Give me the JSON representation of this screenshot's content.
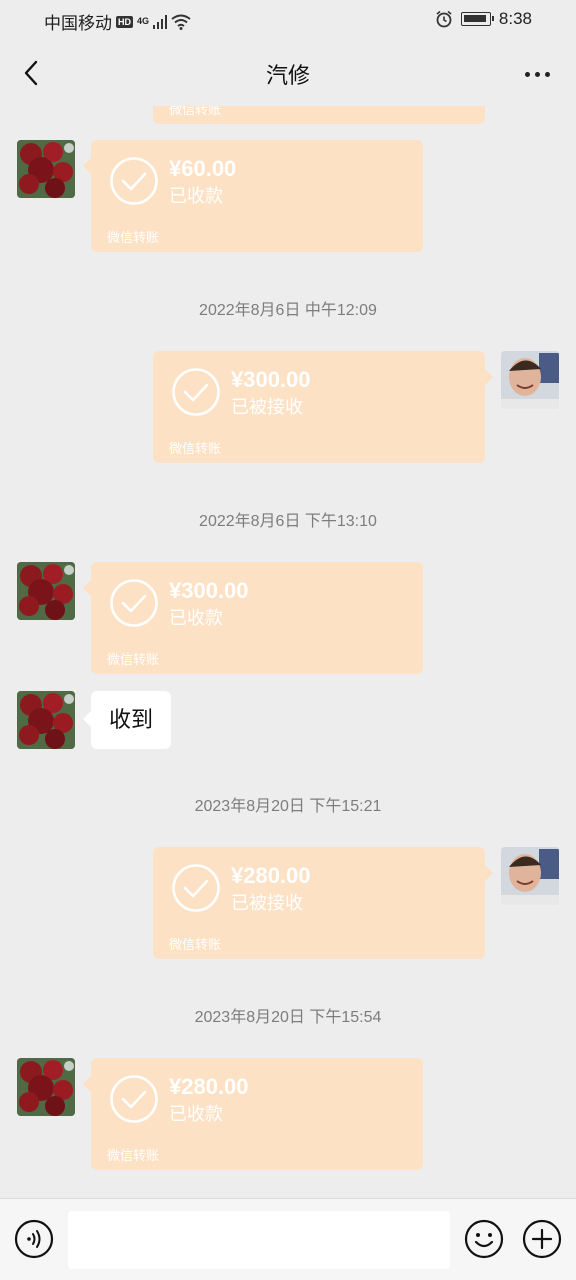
{
  "status_bar": {
    "carrier": "中国移动",
    "hd": "HD",
    "network": "4G",
    "time": "8:38"
  },
  "header": {
    "title": "汽修"
  },
  "messages": {
    "top_partial": {
      "footer": "微信转账"
    },
    "m1": {
      "amount": "¥60.00",
      "status": "已收款",
      "footer": "微信转账"
    },
    "t1": "2022年8月6日 中午12:09",
    "m2": {
      "amount": "¥300.00",
      "status": "已被接收",
      "footer": "微信转账"
    },
    "t2": "2022年8月6日 下午13:10",
    "m3": {
      "amount": "¥300.00",
      "status": "已收款",
      "footer": "微信转账"
    },
    "m4": {
      "text": "收到"
    },
    "t3": "2023年8月20日 下午15:21",
    "m5": {
      "amount": "¥280.00",
      "status": "已被接收",
      "footer": "微信转账"
    },
    "t4": "2023年8月20日 下午15:54",
    "m6": {
      "amount": "¥280.00",
      "status": "已收款",
      "footer": "微信转账"
    }
  },
  "colors": {
    "transfer_bubble": "#fde1c4",
    "chat_bg": "#ededed"
  },
  "icons": {
    "back": "chevron-left-icon",
    "more": "more-dots-icon",
    "check": "check-circle-icon",
    "voice": "voice-icon",
    "emoji": "emoji-icon",
    "plus": "plus-circle-icon"
  }
}
